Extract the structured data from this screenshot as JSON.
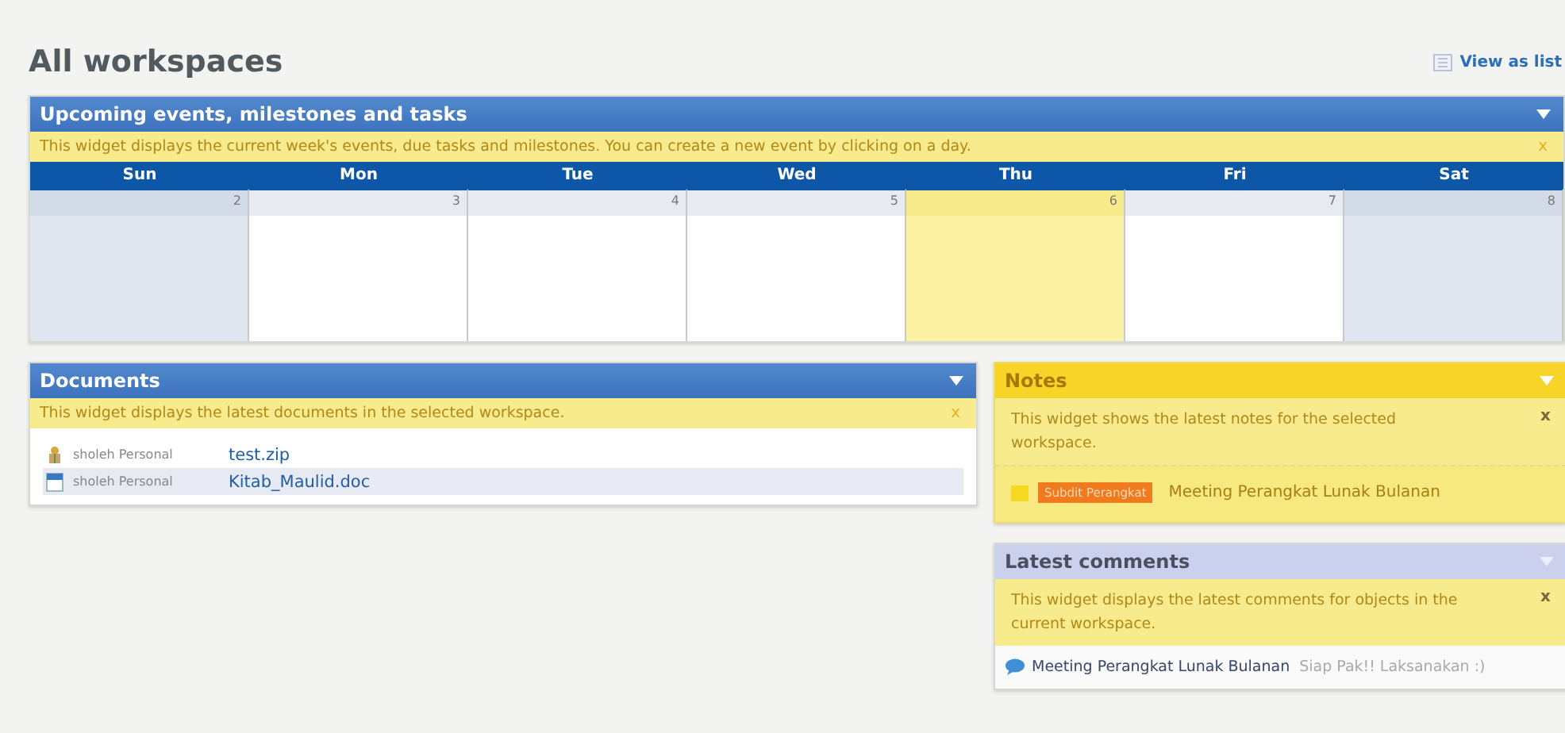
{
  "page": {
    "title": "All workspaces",
    "view_link": "View as list"
  },
  "calendar": {
    "title": "Upcoming events, milestones and tasks",
    "info": "This widget displays the current week's events, due tasks and milestones. You can create a new event by clicking on a day.",
    "close": "x",
    "days": [
      {
        "name": "Sun",
        "date": "2",
        "today": false,
        "weekend": true
      },
      {
        "name": "Mon",
        "date": "3",
        "today": false,
        "weekend": false
      },
      {
        "name": "Tue",
        "date": "4",
        "today": false,
        "weekend": false
      },
      {
        "name": "Wed",
        "date": "5",
        "today": false,
        "weekend": false
      },
      {
        "name": "Thu",
        "date": "6",
        "today": true,
        "weekend": false
      },
      {
        "name": "Fri",
        "date": "7",
        "today": false,
        "weekend": false
      },
      {
        "name": "Sat",
        "date": "8",
        "today": false,
        "weekend": true
      }
    ]
  },
  "documents": {
    "title": "Documents",
    "info": "This widget displays the latest documents in the selected workspace.",
    "close": "x",
    "items": [
      {
        "kind": "zip",
        "workspace": "sholeh Personal",
        "name": "test.zip",
        "selected": false
      },
      {
        "kind": "doc",
        "workspace": "sholeh Personal",
        "name": "Kitab_Maulid.doc",
        "selected": true
      }
    ]
  },
  "notes": {
    "title": "Notes",
    "info": "This widget shows the latest notes for the selected workspace.",
    "close": "x",
    "items": [
      {
        "tag": "Subdit Perangkat",
        "color": "#f07a1e",
        "title": "Meeting Perangkat Lunak Bulanan"
      }
    ]
  },
  "comments": {
    "title": "Latest comments",
    "info": "This widget displays the latest comments for objects in the current workspace.",
    "close": "x",
    "items": [
      {
        "object": "Meeting Perangkat Lunak Bulanan",
        "text": "Siap Pak!! Laksanakan :)"
      }
    ]
  }
}
